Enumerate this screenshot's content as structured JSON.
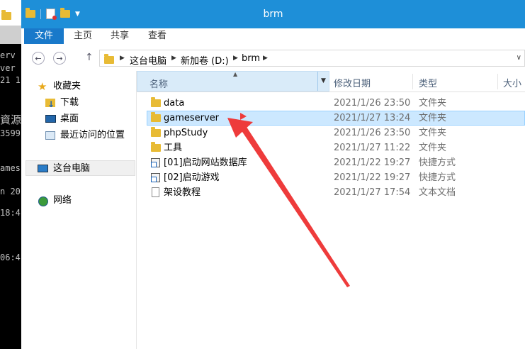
{
  "console": {
    "lines": [
      "erv",
      "ver",
      "21 1",
      "資源",
      "3599",
      "ames",
      "n 20",
      "18:4",
      "06:4"
    ]
  },
  "window": {
    "title": "brm"
  },
  "ribbon": {
    "tabs": [
      "文件",
      "主页",
      "共享",
      "查看"
    ]
  },
  "address": {
    "crumbs": [
      "这台电脑",
      "新加卷 (D:)",
      "brm"
    ]
  },
  "navpane": {
    "favorites_label": "收藏夹",
    "favorites": [
      "下载",
      "桌面",
      "最近访问的位置"
    ],
    "this_pc": "这台电脑",
    "network": "网络"
  },
  "columns": {
    "name": "名称",
    "date": "修改日期",
    "type": "类型",
    "size": "大小"
  },
  "files": [
    {
      "name": "data",
      "date": "2021/1/26 23:50",
      "type": "文件夹",
      "icon": "folder-icon",
      "selected": false
    },
    {
      "name": "gameserver",
      "date": "2021/1/27 13:24",
      "type": "文件夹",
      "icon": "folder-icon",
      "selected": true
    },
    {
      "name": "phpStudy",
      "date": "2021/1/26 23:50",
      "type": "文件夹",
      "icon": "folder-icon",
      "selected": false
    },
    {
      "name": "工具",
      "date": "2021/1/27 11:22",
      "type": "文件夹",
      "icon": "folder-icon",
      "selected": false
    },
    {
      "name": "[01]启动网站数据库",
      "date": "2021/1/22 19:27",
      "type": "快捷方式",
      "icon": "shortcut-icon",
      "selected": false
    },
    {
      "name": "[02]启动游戏",
      "date": "2021/1/22 19:27",
      "type": "快捷方式",
      "icon": "shortcut-icon",
      "selected": false
    },
    {
      "name": "架设教程",
      "date": "2021/1/27 17:54",
      "type": "文本文档",
      "icon": "text-file-icon",
      "selected": false
    }
  ],
  "colors": {
    "accent": "#1e8fd8",
    "file_tab": "#1979ca",
    "selection": "#cce8ff",
    "annotation_arrow": "#ee3b3b"
  }
}
